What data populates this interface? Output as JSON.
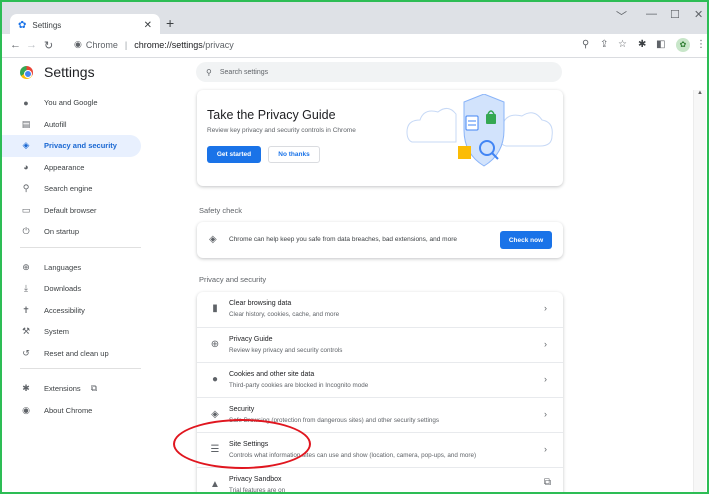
{
  "tab": {
    "title": "Settings",
    "close": "✕",
    "new": "+"
  },
  "window": {
    "min": "﹀",
    "minimize": "—",
    "maximize": "☐",
    "close": "✕"
  },
  "addressbar": {
    "site_name": "Chrome",
    "url_host": "chrome://settings",
    "url_path": "/privacy"
  },
  "header": {
    "title": "Settings"
  },
  "search": {
    "placeholder": "Search settings"
  },
  "sidebar": {
    "items": [
      {
        "label": "You and Google",
        "icon": "person-icon"
      },
      {
        "label": "Autofill",
        "icon": "clipboard-icon"
      },
      {
        "label": "Privacy and security",
        "icon": "shield-icon"
      },
      {
        "label": "Appearance",
        "icon": "palette-icon"
      },
      {
        "label": "Search engine",
        "icon": "search-icon"
      },
      {
        "label": "Default browser",
        "icon": "browser-icon"
      },
      {
        "label": "On startup",
        "icon": "power-icon"
      },
      {
        "label": "Languages",
        "icon": "globe-icon"
      },
      {
        "label": "Downloads",
        "icon": "download-icon"
      },
      {
        "label": "Accessibility",
        "icon": "accessibility-icon"
      },
      {
        "label": "System",
        "icon": "wrench-icon"
      },
      {
        "label": "Reset and clean up",
        "icon": "restore-icon"
      },
      {
        "label": "Extensions",
        "icon": "puzzle-icon"
      },
      {
        "label": "About Chrome",
        "icon": "chrome-icon"
      }
    ]
  },
  "privacy_guide": {
    "title": "Take the Privacy Guide",
    "description": "Review key privacy and security controls in Chrome",
    "get_started": "Get started",
    "no_thanks": "No thanks"
  },
  "safety_check": {
    "section_title": "Safety check",
    "text": "Chrome can help keep you safe from data breaches, bad extensions, and more",
    "button": "Check now"
  },
  "privacy_section": {
    "title": "Privacy and security",
    "rows": [
      {
        "title": "Clear browsing data",
        "subtitle": "Clear history, cookies, cache, and more",
        "icon": "trash-icon"
      },
      {
        "title": "Privacy Guide",
        "subtitle": "Review key privacy and security controls",
        "icon": "compass-icon"
      },
      {
        "title": "Cookies and other site data",
        "subtitle": "Third-party cookies are blocked in Incognito mode",
        "icon": "cookie-icon"
      },
      {
        "title": "Security",
        "subtitle": "Safe Browsing (protection from dangerous sites) and other security settings",
        "icon": "security-shield-icon"
      },
      {
        "title": "Site Settings",
        "subtitle": "Controls what information sites can use and show (location, camera, pop-ups, and more)",
        "icon": "sliders-icon"
      },
      {
        "title": "Privacy Sandbox",
        "subtitle": "Trial features are on",
        "icon": "flask-icon"
      }
    ]
  },
  "colors": {
    "accent": "#1a73e8",
    "frame": "#2dbd55",
    "highlight": "#e0161f",
    "active_bg": "#e8f0fe"
  }
}
